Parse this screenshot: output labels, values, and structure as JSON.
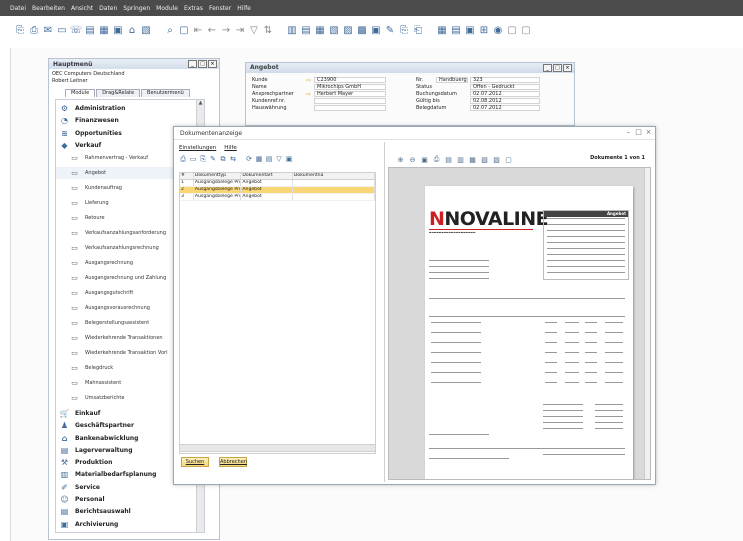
{
  "menubar": [
    "Datei",
    "Bearbeiten",
    "Ansicht",
    "Daten",
    "Springen",
    "Module",
    "Extras",
    "Fenster",
    "Hilfe"
  ],
  "main_menu": {
    "title": "Hauptmenü",
    "company": "OEC Computers Deutschland",
    "user": "Robert Leitner",
    "tabs": [
      "Module",
      "Drag&Relate",
      "Benutzermenü"
    ],
    "modules_top": [
      "Administration",
      "Finanzwesen",
      "Opportunities",
      "Verkauf"
    ],
    "sales_items": [
      "Rahmenvertrag - Verkauf",
      "Angebot",
      "Kundenauftrag",
      "Lieferung",
      "Retoure",
      "Verkaufsanzahlungsanforderung",
      "Verkaufsanzahlungsrechnung",
      "Ausgangsrechnung",
      "Ausgangsrechnung und Zahlung",
      "Ausgangsgutschrift",
      "Ausgangsvorausrechnung",
      "Belegerstellungsassistent",
      "Wiederkehrende Transaktionen",
      "Wiederkehrende Transaktion Vorl",
      "Belegdruck",
      "Mahnassistent",
      "Umsatzberichte"
    ],
    "modules_bottom": [
      "Einkauf",
      "Geschäftspartner",
      "Bankenabwicklung",
      "Lagerverwaltung",
      "Produktion",
      "Materialbedarfsplanung",
      "Service",
      "Personal",
      "Berichtsauswahl",
      "Archivierung"
    ]
  },
  "angebot": {
    "title": "Angebot",
    "left_fields": [
      {
        "label": "Kunde",
        "value": "C23900"
      },
      {
        "label": "Name",
        "value": "Mikrochips GmbH"
      },
      {
        "label": "Ansprechpartner",
        "value": "Herbert Mayer"
      },
      {
        "label": "Kundenref.nr.",
        "value": ""
      },
      {
        "label": "Hauswährung",
        "value": ""
      }
    ],
    "right_fields": [
      {
        "label": "Nr.",
        "mid": "Handbuerg",
        "value": "323"
      },
      {
        "label": "Status",
        "value": "Offen - Gedruckt"
      },
      {
        "label": "Buchungsdatum",
        "value": "02.07.2012"
      },
      {
        "label": "Gültig bis",
        "value": "02.08.2012"
      },
      {
        "label": "Belegdatum",
        "value": "02.07.2012"
      }
    ]
  },
  "doc_viewer": {
    "title": "Dokumentenanzeige",
    "menu": [
      "Einstellungen",
      "Hilfe"
    ],
    "columns": [
      "#",
      "Dokumenttyp",
      "Dokumentart",
      "Dokumentna"
    ],
    "rows": [
      [
        "1",
        "Ausgangsbelege Prin",
        "Angebot",
        ""
      ],
      [
        "2",
        "Ausgangsbelege Prin",
        "Angebot",
        ""
      ],
      [
        "3",
        "Ausgangsbelege Prin",
        "Angebot",
        ""
      ]
    ],
    "buttons": {
      "search": "Suchen",
      "cancel": "Abbrechen"
    },
    "doc_count": "Dokumente 1 von 1",
    "logo_text": "NOVALINE",
    "doc_heading": "Angebot"
  }
}
